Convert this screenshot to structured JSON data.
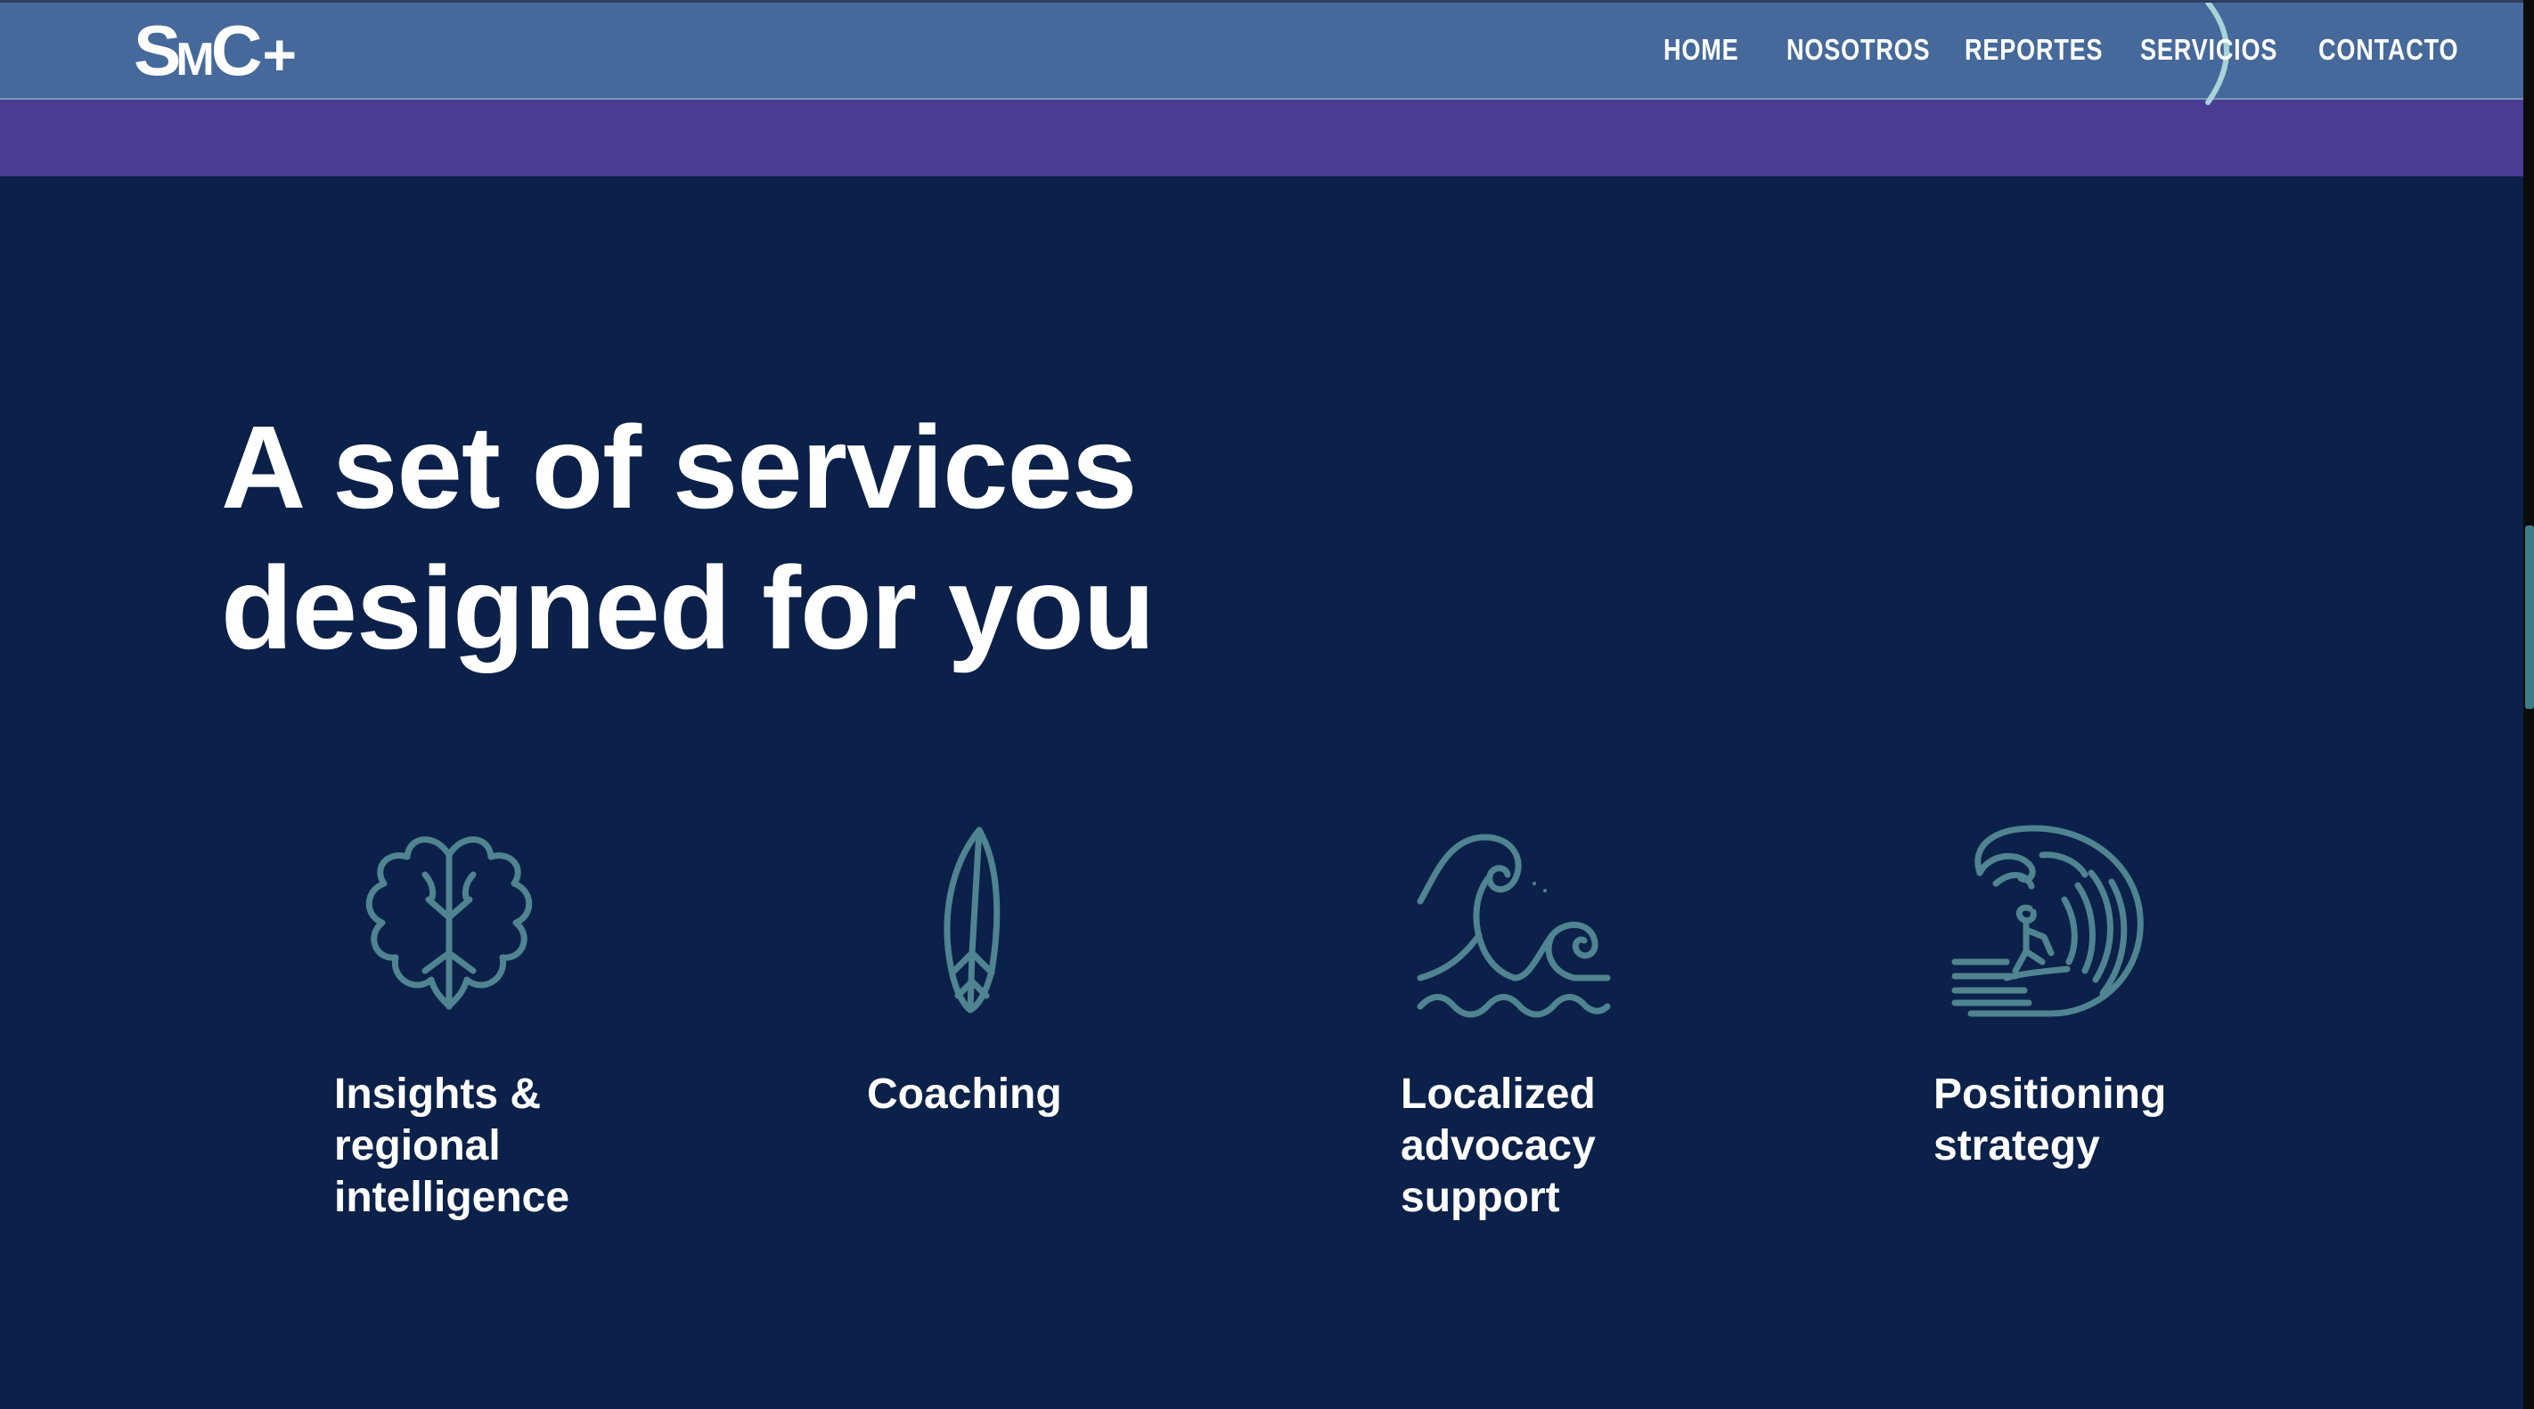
{
  "header": {
    "logo": {
      "s": "S",
      "m": "M",
      "c": "C",
      "plus": "+"
    },
    "nav": [
      {
        "label": "HOME"
      },
      {
        "label": "NOSOTROS"
      },
      {
        "label": "REPORTES"
      },
      {
        "label": "SERVICIOS"
      },
      {
        "label": "CONTACTO"
      }
    ],
    "active_nav": "SERVICIOS"
  },
  "hero": {
    "line1": "A set of services",
    "line2": "designed for you"
  },
  "services": [
    {
      "icon": "brain-icon",
      "lines": [
        "Insights &",
        "regional",
        "intelligence"
      ]
    },
    {
      "icon": "surfboard-icon",
      "lines": [
        "Coaching"
      ]
    },
    {
      "icon": "waves-icon",
      "lines": [
        "Localized",
        "advocacy",
        "support"
      ]
    },
    {
      "icon": "surfer-wave-icon",
      "lines": [
        "Positioning",
        "strategy"
      ]
    }
  ],
  "colors": {
    "background": "#0c2149",
    "header": "#45699a",
    "strip": "#4a3b93",
    "icon": "#4f8490",
    "text": "#ffffff",
    "scroll_thumb": "#3a7d86"
  }
}
